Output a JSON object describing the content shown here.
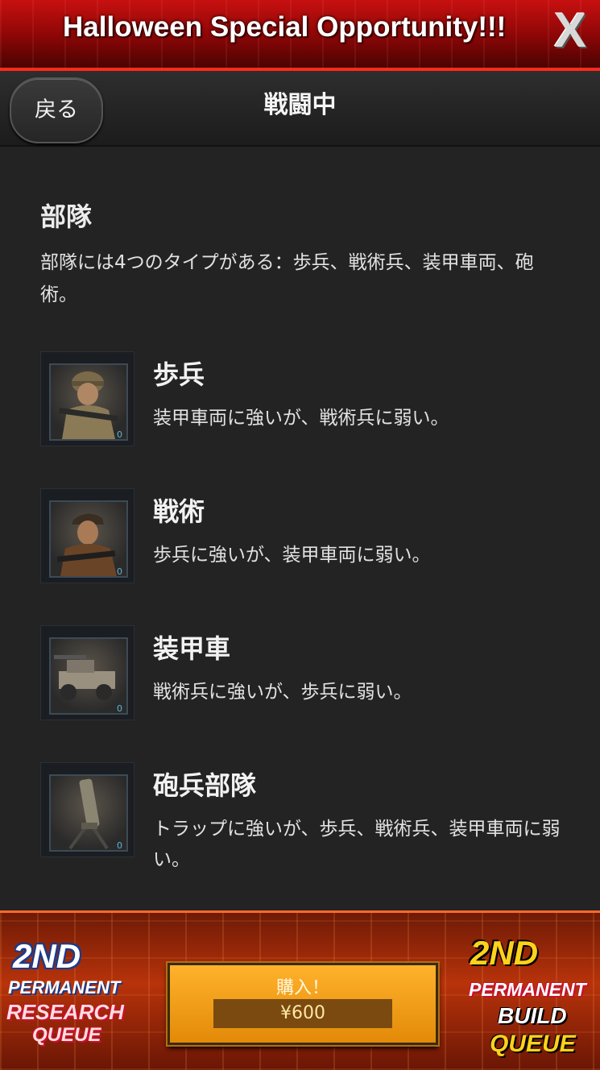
{
  "promo": {
    "title": "Halloween Special Opportunity!!!",
    "close_label": "X"
  },
  "header": {
    "back_label": "戻る",
    "title": "戦闘中"
  },
  "section": {
    "title": "部隊",
    "description": "部隊には4つのタイプがある：歩兵、戦術兵、装甲車両、砲術。"
  },
  "units": [
    {
      "name": "歩兵",
      "description": "装甲車両に強いが、戦術兵に弱い。",
      "count": "0",
      "icon": "soldier-icon"
    },
    {
      "name": "戦術",
      "description": "歩兵に強いが、装甲車両に弱い。",
      "count": "0",
      "icon": "tactical-soldier-icon"
    },
    {
      "name": "装甲車",
      "description": "戦術兵に強いが、歩兵に弱い。",
      "count": "0",
      "icon": "armored-vehicle-icon"
    },
    {
      "name": "砲兵部隊",
      "description": "トラップに強いが、歩兵、戦術兵、装甲車両に弱い。",
      "count": "0",
      "icon": "mortar-icon"
    }
  ],
  "bottom_offer": {
    "left_badge": {
      "line1": "2ND",
      "line2": "PERMANENT",
      "line3": "RESEARCH",
      "line4": "QUEUE"
    },
    "right_badge": {
      "line1": "2ND",
      "line2": "PERMANENT",
      "line3": "BUILD",
      "line4": "QUEUE"
    },
    "buy_label": "購入！",
    "price": "¥600"
  },
  "colors": {
    "background": "#232323",
    "promo_red": "#c81010",
    "buy_orange": "#ffb22c",
    "count_blue": "#5fb4d6"
  }
}
